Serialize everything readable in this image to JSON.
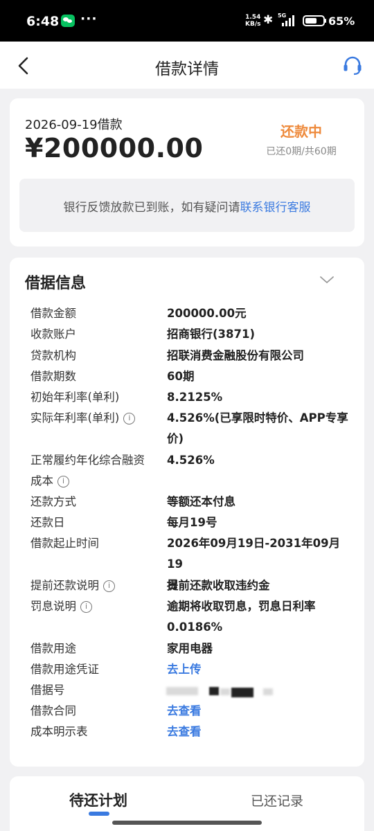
{
  "status_bar": {
    "time": "6:48",
    "speed_value": "1.54",
    "speed_unit": "KB/s",
    "network": "5G",
    "battery": "65%",
    "battery_level": 0.65
  },
  "header": {
    "title": "借款详情"
  },
  "loan": {
    "date_label": "2026-09-19借款",
    "amount": "¥200000.00",
    "status": "还款中",
    "progress": "已还0期/共60期",
    "notice_text": "银行反馈放款已到账，如有疑问请",
    "notice_link": "联系银行客服"
  },
  "info": {
    "title": "借据信息",
    "rows": [
      {
        "label": "借款金额",
        "value": "200000.00元"
      },
      {
        "label": "收款账户",
        "value": "招商银行(3871)"
      },
      {
        "label": "贷款机构",
        "value": "招联消费金融股份有限公司"
      },
      {
        "label": "借款期数",
        "value": "60期"
      },
      {
        "label": "初始年利率(单利)",
        "value": "8.2125%"
      },
      {
        "label": "实际年利率(单利)",
        "value": "4.526%(已享限时特价、APP专享",
        "value2": "价)"
      },
      {
        "label": "正常履约年化综合融资",
        "label2": "成本",
        "value": "4.526%"
      },
      {
        "label": "还款方式",
        "value": "等额还本付息"
      },
      {
        "label": "还款日",
        "value": "每月19号"
      },
      {
        "label": "借款起止时间",
        "value": "2026年09月19日-2031年09月19",
        "value2": "日"
      },
      {
        "label": "提前还款说明",
        "value": "提前还款收取违约金"
      },
      {
        "label": "罚息说明",
        "value": "逾期将收取罚息，罚息日利率",
        "value2": "0.0186%"
      },
      {
        "label": "借款用途",
        "value": "家用电器"
      },
      {
        "label": "借款用途凭证",
        "value": "去上传"
      },
      {
        "label": "借据号",
        "value": ""
      },
      {
        "label": "借款合同",
        "value": "去查看"
      },
      {
        "label": "成本明示表",
        "value": "去查看"
      }
    ]
  },
  "tabs": {
    "pending": "待还计划",
    "history": "已还记录"
  },
  "colors": {
    "accent": "#3a7ae0",
    "status": "#ee8a3c"
  },
  "icons": [
    "back-icon",
    "customer-service-icon",
    "chevron-down-icon",
    "info-icon"
  ]
}
